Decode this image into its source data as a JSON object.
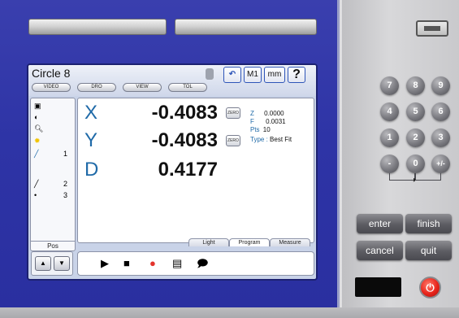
{
  "screen": {
    "feature_title": "Circle 8",
    "mode_buttons": [
      "VIDEO",
      "DRO",
      "VIEW",
      "TOL"
    ],
    "icon_buttons": {
      "m1": "M1",
      "units": "mm",
      "help": "?"
    },
    "tool_numbers": [
      "1",
      "2",
      "3"
    ],
    "pos_label": "Pos",
    "readout": {
      "x_label": "X",
      "x_value": "-0.4083",
      "y_label": "Y",
      "y_value": "-0.4083",
      "d_label": "D",
      "d_value": "0.4177",
      "zero_label": "ZERO",
      "z_label": "Z",
      "z_value": "0.0000",
      "f_label": "F",
      "f_value": "0.0031",
      "pts_label": "Pts",
      "pts_value": "10",
      "type_label": "Type :",
      "type_value": "Best Fit"
    },
    "tabs": [
      "Light",
      "Program",
      "Measure"
    ]
  },
  "keypad": {
    "keys": [
      "7",
      "8",
      "9",
      "4",
      "5",
      "6",
      "1",
      "2",
      "3",
      "-",
      "0",
      "+/-"
    ]
  },
  "function_buttons": {
    "enter": "enter",
    "finish": "finish",
    "cancel": "cancel",
    "quit": "quit"
  },
  "colors": {
    "bezel": "#2e34a6",
    "axis_label": "#1f6aa8",
    "power": "#e8251c"
  }
}
